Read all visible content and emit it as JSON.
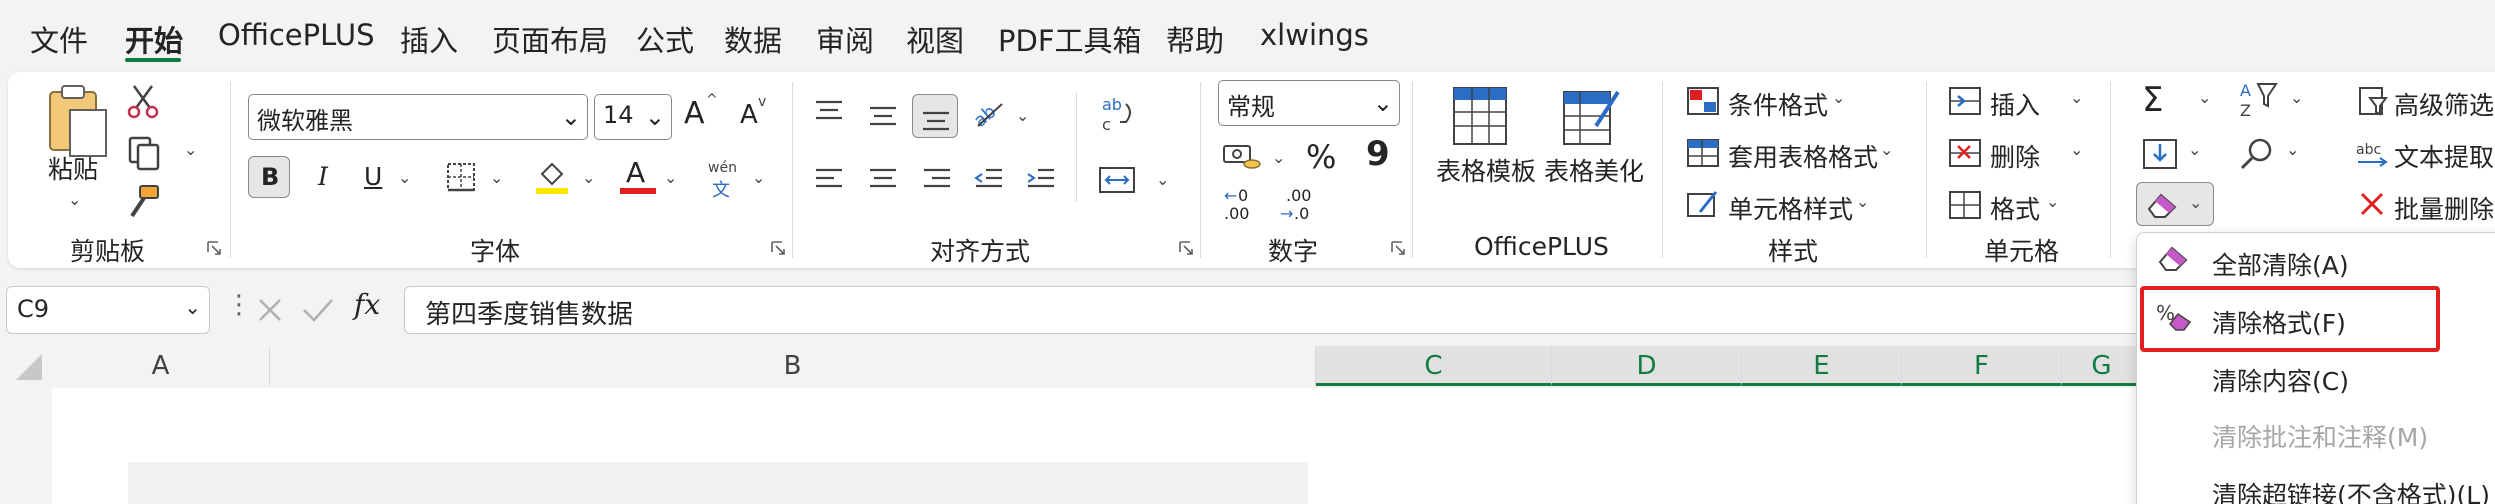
{
  "menu_tabs": [
    "文件",
    "开始",
    "OfficePLUS",
    "插入",
    "页面布局",
    "公式",
    "数据",
    "审阅",
    "视图",
    "PDF工具箱",
    "帮助",
    "xlwings"
  ],
  "clipboard": {
    "paste": "粘贴",
    "group": "剪贴板"
  },
  "font": {
    "name": "微软雅黑",
    "size": "14",
    "bold": "B",
    "italic": "I",
    "underline": "U",
    "grow": "A",
    "shrink": "A",
    "phonetic_top": "wén",
    "phonetic_bottom": "文",
    "group": "字体",
    "color_label": "A"
  },
  "alignment": {
    "group": "对齐方式",
    "wrap": "ab\nc"
  },
  "number": {
    "format": "常规",
    "percent": "%",
    "comma": "9",
    "inc_dec": "←0\n.00",
    "dec_dec": ".00\n→.0",
    "group": "数字"
  },
  "officeplus": {
    "template": "表格模板",
    "beautify": "表格美化",
    "group": "OfficePLUS"
  },
  "styles": {
    "conditional": "条件格式",
    "table_format": "套用表格格式",
    "cell_style": "单元格样式",
    "group": "样式"
  },
  "cells": {
    "insert": "插入",
    "delete": "删除",
    "format": "格式",
    "group": "单元格"
  },
  "editing": {
    "advanced_filter": "高级筛选",
    "text_extract": "文本提取",
    "batch_delete": "批量删除"
  },
  "formula_bar": {
    "name_box": "C9",
    "fx": "fx",
    "content": "第四季度销售数据"
  },
  "columns": [
    "A",
    "B",
    "C",
    "D",
    "E",
    "F",
    "G"
  ],
  "clear_menu": {
    "items": [
      {
        "label": "全部清除(A)",
        "enabled": true
      },
      {
        "label": "清除格式(F)",
        "enabled": true
      },
      {
        "label": "清除内容(C)",
        "enabled": true
      },
      {
        "label": "清除批注和注释(M)",
        "enabled": false
      },
      {
        "label": "清除超链接(不含格式)(L)",
        "enabled": true
      }
    ]
  },
  "colors": {
    "accent": "#107c41",
    "highlight_box": "#e02020",
    "font_color": "#e02020",
    "fill_color": "#ffe600"
  }
}
